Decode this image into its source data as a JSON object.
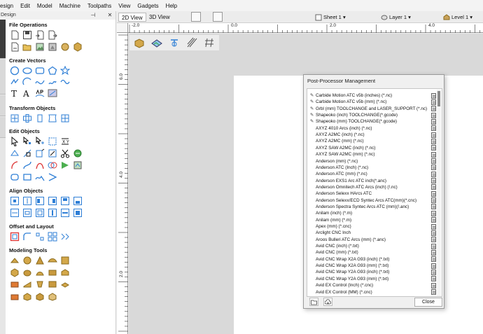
{
  "menu": [
    "esign",
    "Edit",
    "Model",
    "Machine",
    "Toolpaths",
    "View",
    "Gadgets",
    "Help"
  ],
  "panel": {
    "title": "Design"
  },
  "sections": {
    "file_operations": "File Operations",
    "create_vectors": "Create Vectors",
    "transform_objects": "Transform Objects",
    "edit_objects": "Edit Objects",
    "align_objects": "Align Objects",
    "offset_layout": "Offset and Layout",
    "modeling_tools": "Modeling Tools"
  },
  "view_toolbar": {
    "tab_2d": "2D View",
    "tab_3d": "3D View",
    "sheet": "Sheet 1 ▾",
    "layer": "Layer 1 ▾",
    "level": "Level 1 ▾"
  },
  "ruler": {
    "h_labels": [
      "-2.0",
      "0.0",
      "2.0",
      "4.0"
    ],
    "v_labels": [
      "6.0",
      "4.0",
      "2.0"
    ]
  },
  "dialog": {
    "title": "Post-Processor Management",
    "close_label": "Close",
    "items": [
      "Carbide Motion ATC v5b (inches) (*.nc)",
      "Carbide Motion ATC v5b (mm) (*.nc)",
      "Grbl (mm) TOOLCHANGE and LASER_SUPPORT (*.nc)",
      "Shapeoko (inch) TOOLCHANGE(*.gcode)",
      "Shapeoko (mm) TOOLCHANGE(*.gcode)",
      "AXYZ 4010 Arcs (inch) (*.nc)",
      "AXYZ A2MC (inch) (*.nc)",
      "AXYZ A2MC (mm) (*.nc)",
      "AXYZ SAW A2MC (inch) (*.nc)",
      "AXYZ SAW A2MC (mm) (*.nc)",
      "Anderson (mm) (*.nc)",
      "Anderson ATC (Inch) (*.nc)",
      "Anderson ATC (mm) (*.nc)",
      "Anderson EXS1 Arc ATC inch(*.anc)",
      "Anderson Omnitech ATC Arcs (inch) (!.nc)",
      "Anderson Selexx HArcs ATC",
      "Anderson Selexx/ECD Syntec Arcs ATC(mm)(*.cnc)",
      "Anderson Spectra Syntec Arcs ATC (mm)(!.anc)",
      "Anilam (inch) (*.m)",
      "Anilam (mm) (*.m)",
      "Apex (mm) (*.cnc)",
      "Arclight CNC Inch",
      "Aroos Bulleri ATC Arcs (mm) (*.anc)",
      "Avid CNC (inch) (*.txt)",
      "Avid CNC (mm) (*.txt)",
      "Avid CNC Wrap X2A G93 (inch) (*.txt)",
      "Avid CNC Wrap X2A G93 (mm) (*.txt)",
      "Avid CNC Wrap Y2A G93 (inch) (*.txt)",
      "Avid CNC Wrap Y2A G93 (mm) (*.txt)",
      "Avid EX Control (Inch) (*.cnc)",
      "Avid EX Control (MM) (*.cnc)"
    ],
    "custom_count": 5
  },
  "colors": {
    "accent": "#2f7fd6",
    "wood": "#c9a25a"
  }
}
